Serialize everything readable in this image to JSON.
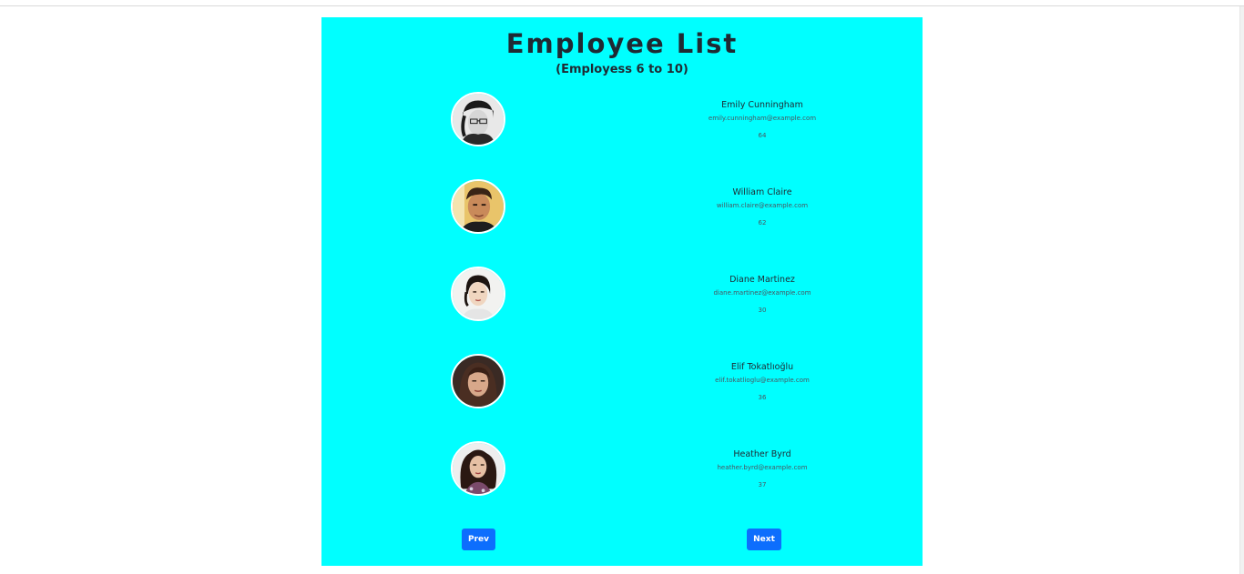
{
  "page": {
    "title": "Employee List",
    "subtitle": "(Employess 6 to 10)"
  },
  "employees": [
    {
      "name": "Emily Cunningham",
      "email": "emily.cunningham@example.com",
      "age": "64",
      "photo": "avatar-woman-glasses-beanie-bw"
    },
    {
      "name": "William Claire",
      "email": "william.claire@example.com",
      "age": "62",
      "photo": "avatar-man-dark-hair"
    },
    {
      "name": "Diane Martinez",
      "email": "diane.martinez@example.com",
      "age": "30",
      "photo": "avatar-woman-short-dark-hair"
    },
    {
      "name": "Elif Tokatlıoğlu",
      "email": "elif.tokatlioglu@example.com",
      "age": "36",
      "photo": "avatar-woman-long-brown-hair"
    },
    {
      "name": "Heather Byrd",
      "email": "heather.byrd@example.com",
      "age": "37",
      "photo": "avatar-woman-curly-hair"
    }
  ],
  "pagination": {
    "prev_label": "Prev",
    "next_label": "Next"
  },
  "colors": {
    "panel_bg": "#00ffff",
    "button_bg": "#0d6efd",
    "text": "#1f2a33"
  }
}
